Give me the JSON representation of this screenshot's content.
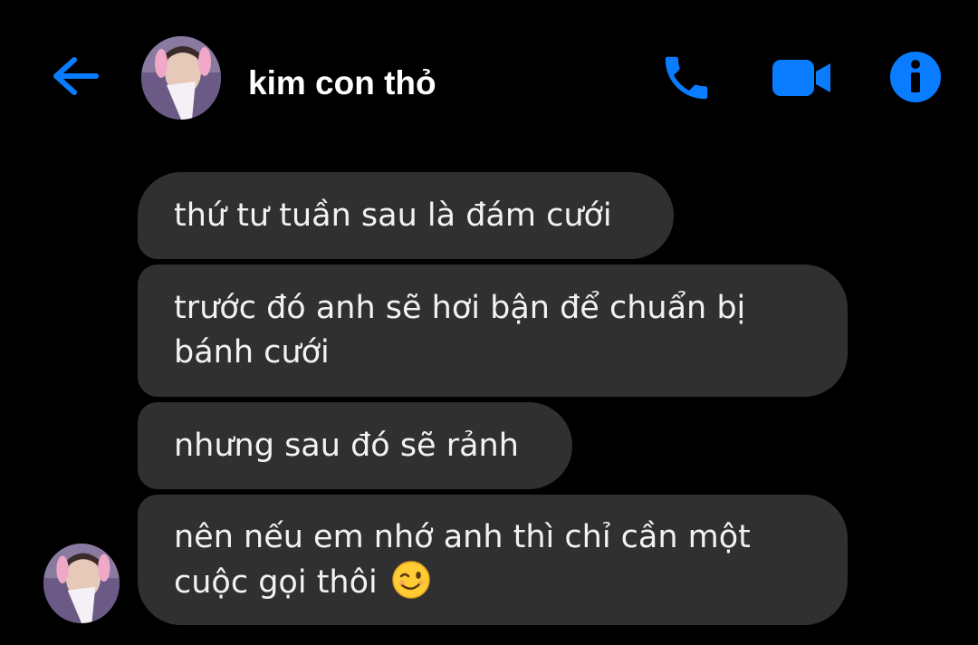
{
  "header": {
    "contact_name": "kim con thỏ",
    "icons": {
      "back": "arrow-left-icon",
      "call": "phone-icon",
      "video": "video-camera-icon",
      "info": "info-icon"
    }
  },
  "messages": [
    {
      "text": "thứ tư tuần sau là đám cưới"
    },
    {
      "text": "trước đó anh sẽ hơi bận để chuẩn bị bánh cưới"
    },
    {
      "text": "nhưng sau đó sẽ rảnh"
    },
    {
      "text": "nên nếu em nhớ anh thì chỉ cần một cuộc gọi thôi",
      "emoji": "winking-face-emoji"
    }
  ],
  "colors": {
    "background": "#000000",
    "accent": "#0a7cff",
    "bubble": "#303030",
    "text": "#ffffff"
  }
}
